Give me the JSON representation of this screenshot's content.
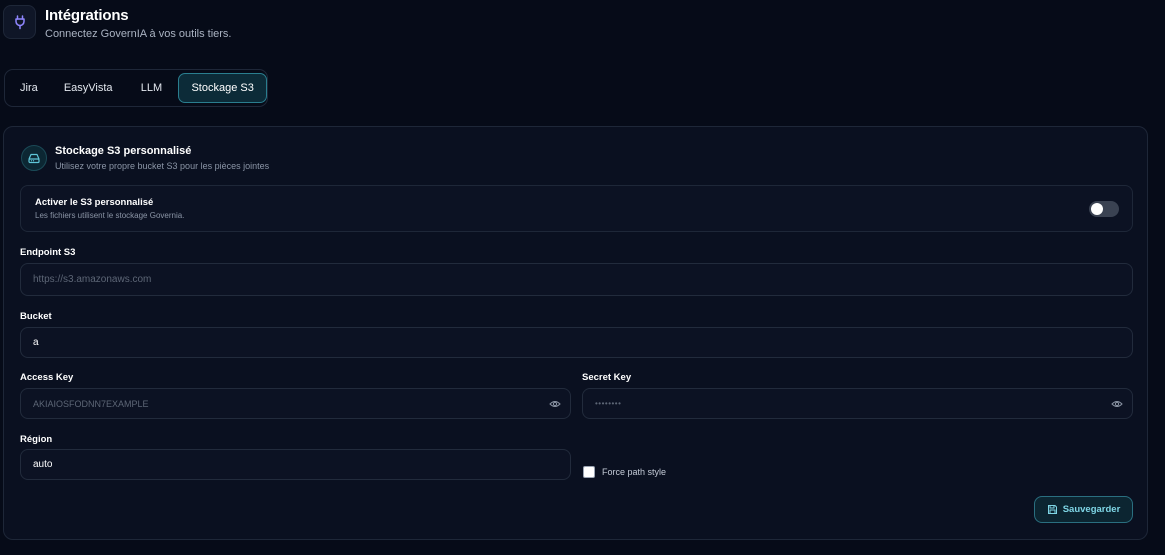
{
  "header": {
    "icon": "plug-icon",
    "title": "Intégrations",
    "subtitle": "Connectez GovernIA à vos outils tiers."
  },
  "tabs": [
    {
      "label": "Jira",
      "active": false
    },
    {
      "label": "EasyVista",
      "active": false
    },
    {
      "label": "LLM",
      "active": false
    },
    {
      "label": "Stockage S3",
      "active": true
    }
  ],
  "card": {
    "icon": "hard-drive-icon",
    "title": "Stockage S3 personnalisé",
    "subtitle": "Utilisez votre propre bucket S3 pour les pièces jointes",
    "toggle": {
      "label": "Activer le S3 personnalisé",
      "description": "Les fichiers utilisent le stockage Governia.",
      "enabled": false
    },
    "fields": {
      "endpoint": {
        "label": "Endpoint S3",
        "value": "",
        "placeholder": "https://s3.amazonaws.com"
      },
      "bucket": {
        "label": "Bucket",
        "value": "a",
        "placeholder": ""
      },
      "access_key": {
        "label": "Access Key",
        "value": "",
        "placeholder": "AKIAIOSFODNN7EXAMPLE"
      },
      "secret_key": {
        "label": "Secret Key",
        "value": "",
        "placeholder": "••••••••"
      },
      "region": {
        "label": "Région",
        "value": "auto",
        "placeholder": ""
      }
    },
    "force_path_style": {
      "label": "Force path style",
      "checked": false
    },
    "save_button": {
      "label": "Sauvegarder",
      "icon": "save-icon"
    }
  },
  "colors": {
    "background": "#060b18",
    "accent": "#7fd6e6",
    "tab_active_border": "#2a7e8f"
  }
}
